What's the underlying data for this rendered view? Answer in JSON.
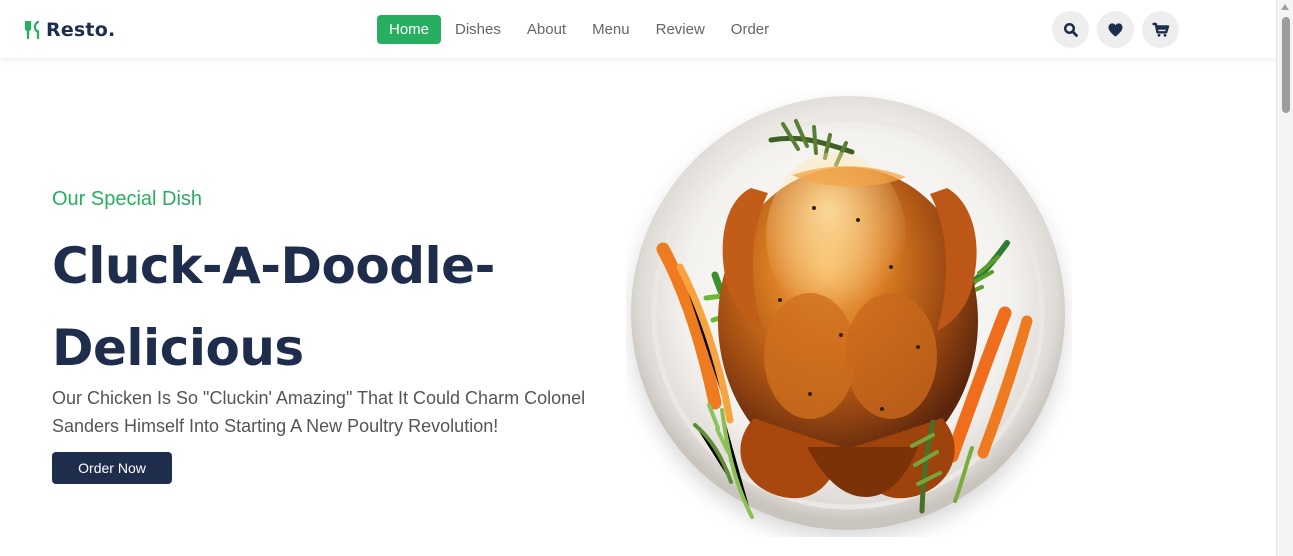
{
  "header": {
    "logo_text": "Resto.",
    "nav_items": [
      {
        "label": "Home",
        "active": true
      },
      {
        "label": "Dishes",
        "active": false
      },
      {
        "label": "About",
        "active": false
      },
      {
        "label": "Menu",
        "active": false
      },
      {
        "label": "Review",
        "active": false
      },
      {
        "label": "Order",
        "active": false
      }
    ],
    "icons": [
      "search-icon",
      "heart-icon",
      "shopping-cart-icon"
    ]
  },
  "hero": {
    "kicker": "Our Special Dish",
    "title_line_1": "Cluck-A-Doodle-",
    "title_line_2": "Delicious",
    "description_line_1": "Our Chicken Is So \"Cluckin' Amazing\" That It Could Charm Colonel",
    "description_line_2": "Sanders Himself Into Starting A New Poultry Revolution!",
    "button_label": "Order Now"
  },
  "theme": {
    "accent": "#27ae60",
    "dark": "#1f2d4d",
    "text_muted": "#666666"
  }
}
